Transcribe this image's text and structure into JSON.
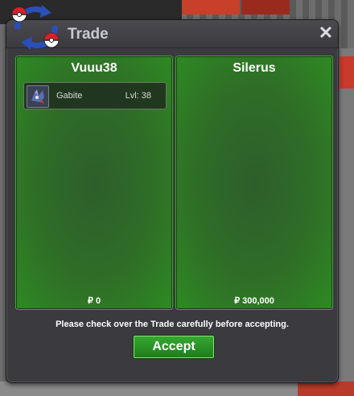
{
  "window": {
    "title": "Trade",
    "close_label": "✕"
  },
  "left_panel": {
    "name": "Vuuu38",
    "money": "₽ 0",
    "items": [
      {
        "name": "Gabite",
        "level": "Lvl: 38"
      }
    ]
  },
  "right_panel": {
    "name": "Silerus",
    "money": "₽ 300,000"
  },
  "notice": "Please check over the Trade carefully before accepting.",
  "accept_label": "Accept",
  "colors": {
    "panel_green": "#2f6e27",
    "panel_border": "#45a835",
    "window_bg": "#3a3a3f",
    "accept_green": "#2a9227"
  }
}
